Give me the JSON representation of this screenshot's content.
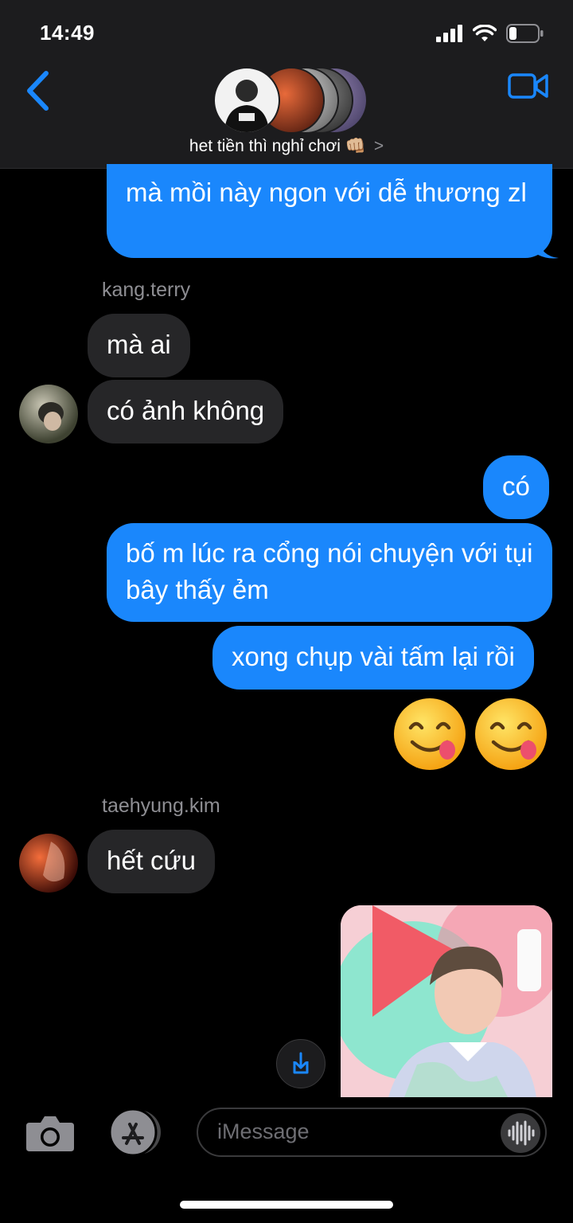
{
  "status_bar": {
    "time": "14:49"
  },
  "header": {
    "group_name": "het tiền thì nghỉ chơi",
    "group_emoji": "👊🏼",
    "chevron": ">"
  },
  "messages": {
    "m1": "mà mồi này ngon với dễ thương zl",
    "sender1": "kang.terry",
    "m2": "mà ai",
    "m3": "có ảnh không",
    "m4": "có",
    "m5": "bố m lúc ra cổng nói chuyện với tụi bây thấy ẻm",
    "m6": "xong chụp vài tấm lại rồi",
    "sender2": "taehyung.kim",
    "m7": "hết cứu"
  },
  "input": {
    "placeholder": "iMessage"
  },
  "colors": {
    "accent": "#1a87fc",
    "incoming": "#262628",
    "header_bg": "#1c1c1e"
  },
  "icons": [
    "back-chevron-icon",
    "video-camera-icon",
    "camera-icon",
    "app-store-icon",
    "audio-waveform-icon",
    "save-download-icon"
  ]
}
